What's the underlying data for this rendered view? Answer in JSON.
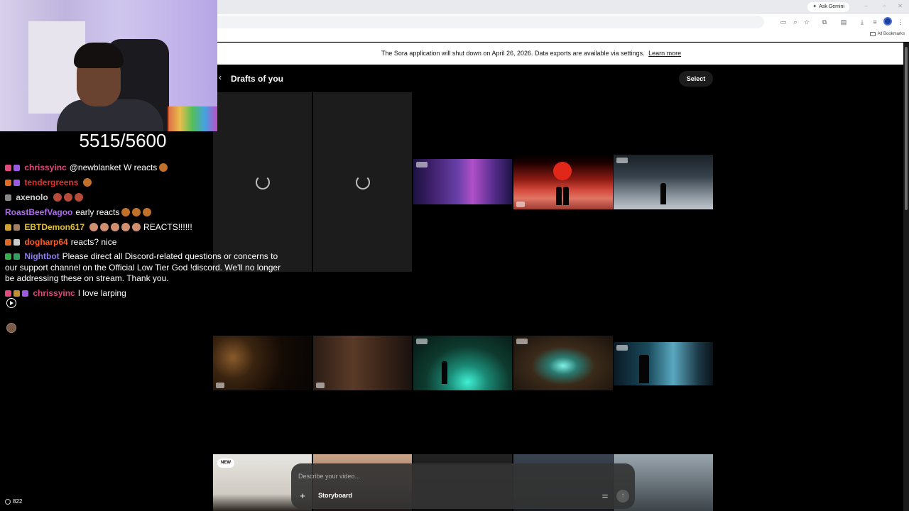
{
  "browser": {
    "ask_gemini": "Ask Gemini",
    "all_bookmarks": "All Bookmarks"
  },
  "banner": {
    "message": "The Sora application will shut down on April 26, 2026. Data exports are available via settings.",
    "link": "Learn more"
  },
  "page": {
    "title": "Drafts of you",
    "select_label": "Select"
  },
  "tiles": {
    "new_badge": "NEW"
  },
  "composer": {
    "placeholder": "Describe your video...",
    "storyboard_label": "Storyboard"
  },
  "stream": {
    "sub_counter": "5515/5600",
    "viewer_count": "822",
    "chat": [
      {
        "user": "chrissyinc",
        "message": "@newblanket W reacts",
        "color": "#e4487c"
      },
      {
        "user": "tendergreens",
        "message": "",
        "color": "#e0312a"
      },
      {
        "user": "axenolo",
        "message": "",
        "color": "#cfcfcf"
      },
      {
        "user": "RoastBeefVagoo",
        "message": "early reacts",
        "color": "#b06bf0"
      },
      {
        "user": "EBTDemon617",
        "message": "REACTS!!!!!!",
        "color": "#e6c02a"
      },
      {
        "user": "dogharp64",
        "message": "reacts? nice",
        "color": "#ff5a1f"
      },
      {
        "user": "Nightbot",
        "message": "Please direct all Discord-related questions or concerns to our support channel on the Official Low Tier God !discord. We'll no longer be addressing these on stream. Thank you.",
        "color": "#8f7cf0"
      },
      {
        "user": "chrissyinc",
        "message": "I love larping",
        "color": "#e4487c"
      }
    ]
  }
}
